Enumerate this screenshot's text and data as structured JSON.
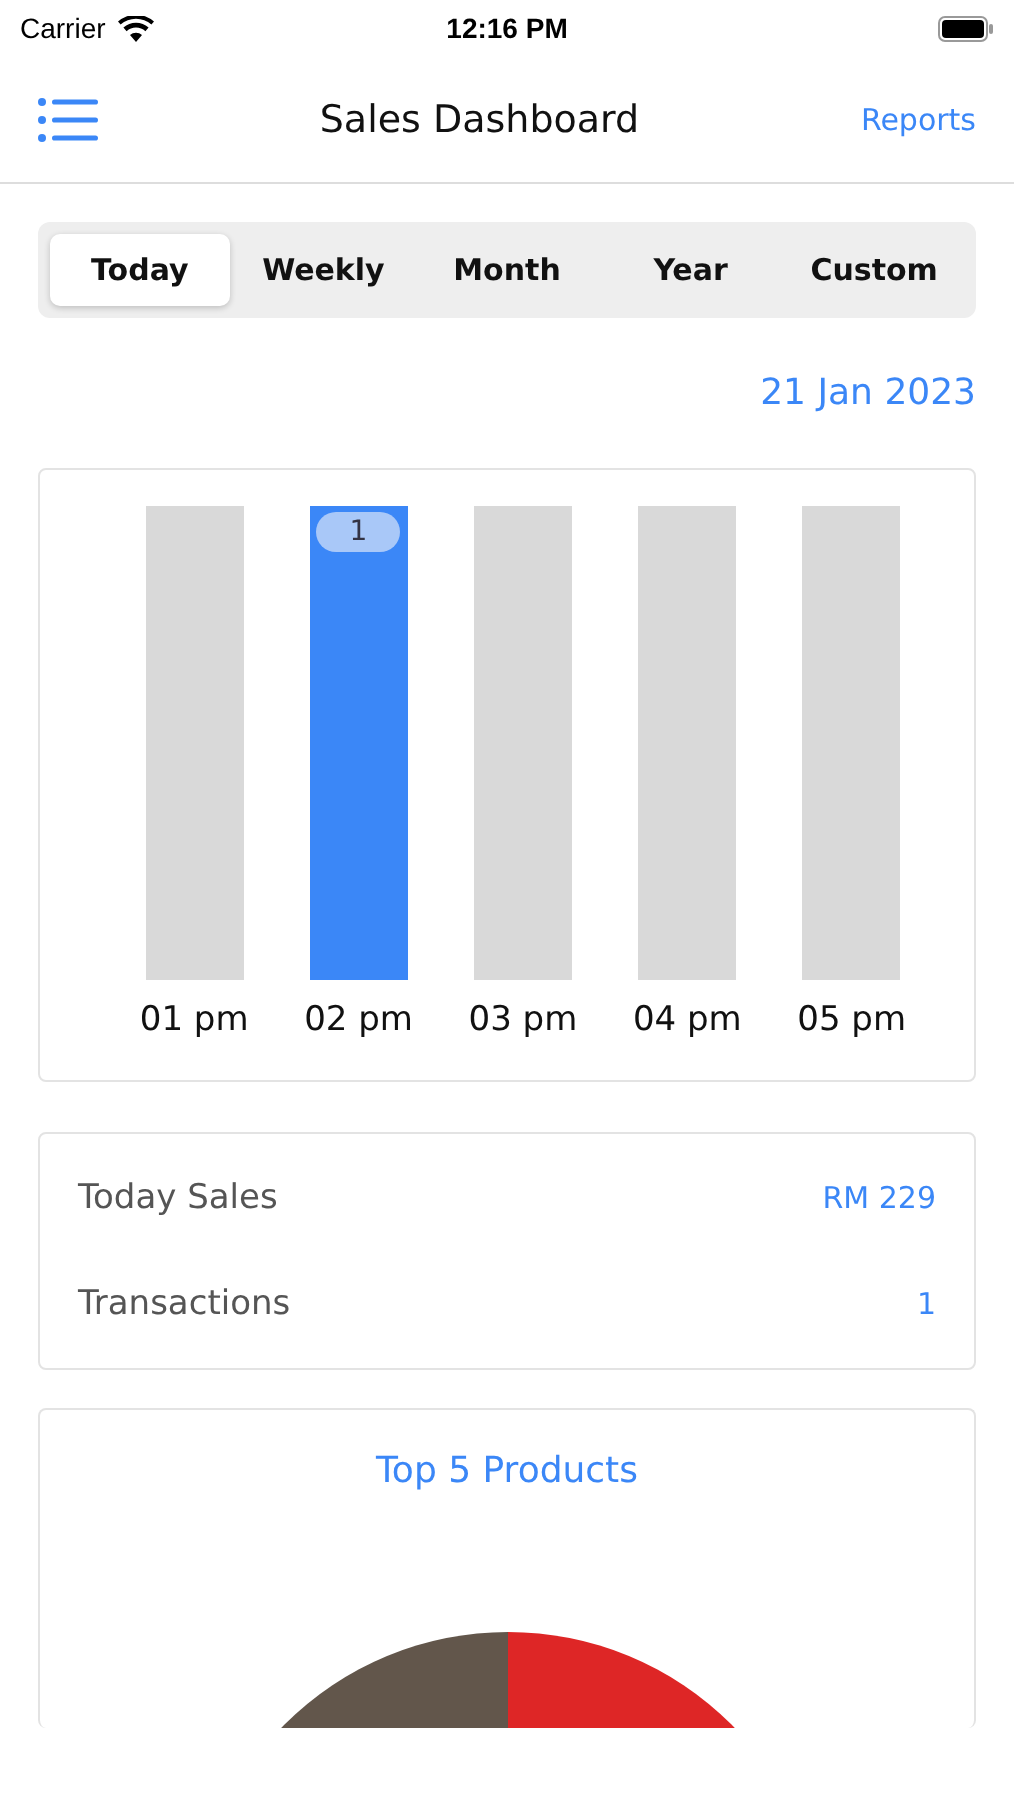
{
  "status_bar": {
    "carrier": "Carrier",
    "time": "12:16 PM"
  },
  "nav": {
    "title": "Sales Dashboard",
    "action": "Reports"
  },
  "tabs": [
    {
      "label": "Today",
      "selected": true
    },
    {
      "label": "Weekly",
      "selected": false
    },
    {
      "label": "Month",
      "selected": false
    },
    {
      "label": "Year",
      "selected": false
    },
    {
      "label": "Custom",
      "selected": false
    }
  ],
  "date": "21 Jan 2023",
  "hours": [
    {
      "label": "01 pm",
      "selected": false
    },
    {
      "label": "02 pm",
      "selected": true,
      "value_label": "1"
    },
    {
      "label": "03 pm",
      "selected": false
    },
    {
      "label": "04 pm",
      "selected": false
    },
    {
      "label": "05 pm",
      "selected": false
    }
  ],
  "summary": [
    {
      "label": "Today Sales",
      "value": "RM 229"
    },
    {
      "label": "Transactions",
      "value": "1"
    }
  ],
  "products": {
    "title": "Top 5 Products"
  }
}
